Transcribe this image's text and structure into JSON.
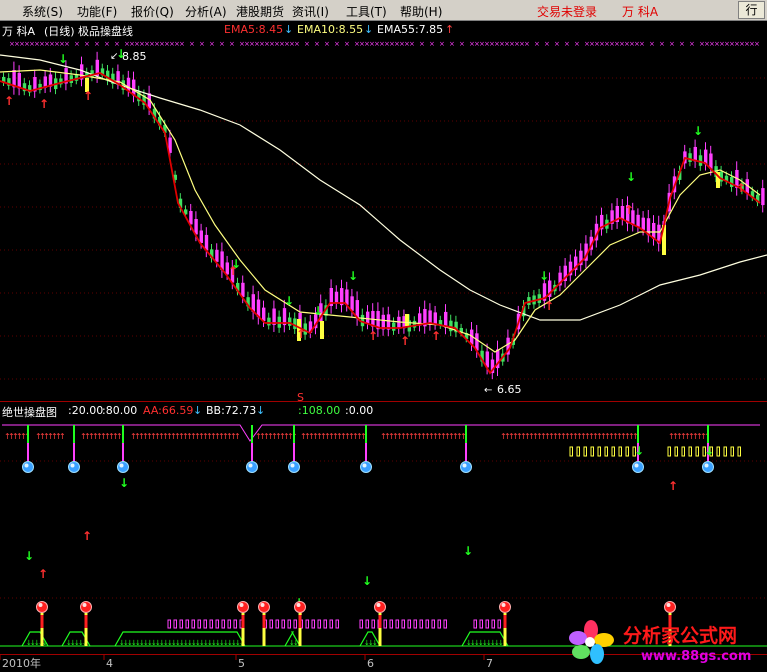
{
  "menu": {
    "items": [
      "系统(S)",
      "功能(F)",
      "报价(Q)",
      "分析(A)",
      "港股期货",
      "资讯(I)",
      "工具(T)",
      "帮助(H)"
    ],
    "login_status": "交易未登录",
    "user": "万 科A",
    "move_label": "行"
  },
  "main_panel": {
    "stock": "万 科A",
    "period": "(日线)",
    "indicator_name": "极品操盘线",
    "ema5": "EMA5:8.45",
    "ema10": "EMA10:8.55",
    "ema55": "EMA55:7.85",
    "high_label": "8.85",
    "low_label": "6.65",
    "marker_s": "S",
    "colors": {
      "up": "#ff40ff",
      "down": "#40e060",
      "ema5": "#e00000",
      "ema10": "#ffff80",
      "ema55": "#ffffe0"
    }
  },
  "sub_panel": {
    "name": "绝世操盘图",
    "v1": ":20.00",
    "v2": ":80.00",
    "aa": "AA:66.59",
    "bb": "BB:72.73",
    "v3": ":108.00",
    "v4": ":0.00",
    "colors": {
      "band_up": "#d01010",
      "band_down": "#30c0d0"
    }
  },
  "time_axis": {
    "labels": [
      "2010年",
      "4",
      "5",
      "6",
      "7"
    ]
  },
  "watermark": {
    "brand": "分析家公式网",
    "url": "www.88gs.com"
  }
}
